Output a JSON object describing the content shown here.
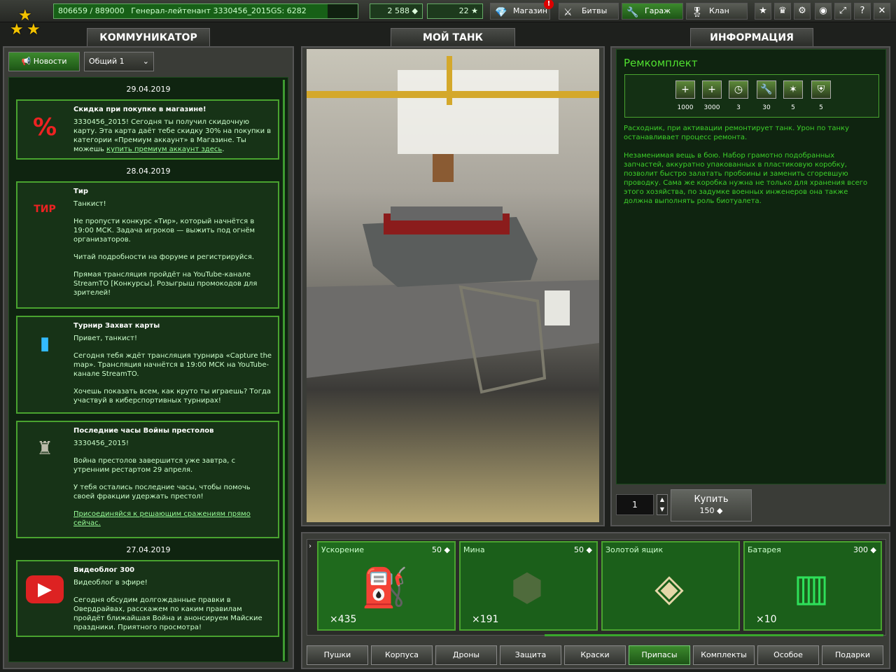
{
  "topbar": {
    "xp": "806659 / 889000",
    "rank": "Генерал-лейтенант 3330456_2015",
    "gs": "GS: 6282",
    "crystals": "2 588",
    "stars": "22",
    "nav": [
      {
        "label": "Магазин",
        "icon": "diamond-icon",
        "badge": "!"
      },
      {
        "label": "Битвы",
        "icon": "crossed-swords-icon"
      },
      {
        "label": "Гараж",
        "icon": "wrench-icon"
      },
      {
        "label": "Клан",
        "icon": "medal-icon"
      }
    ],
    "icons": [
      "star-icon",
      "trophy-icon",
      "gear-icon",
      "sound-icon",
      "fullscreen-icon",
      "help-icon",
      "close-icon"
    ]
  },
  "tabs": {
    "left": "КОММУНИКАТОР",
    "center": "МОЙ ТАНК",
    "right": "ИНФОРМАЦИЯ"
  },
  "comm": {
    "news_btn": "Новости",
    "channel": "Общий 1"
  },
  "news": [
    {
      "date": "29.04.2019",
      "items": [
        {
          "title": "Скидка при покупке в магазине!",
          "lines": [
            "3330456_2015! Сегодня ты получил скидочную карту. Эта карта даёт тебе скидку 30% на покупки в категории «Премиум аккаунт» в Магазине. Ты можешь "
          ],
          "link": "купить премиум аккаунт здесь",
          "tail": ".",
          "img": "%"
        }
      ]
    },
    {
      "date": "28.04.2019",
      "items": [
        {
          "title": "Тир",
          "lines": [
            "Танкист!",
            "Не пропусти конкурс «Тир», который начнётся в 19:00 МСК. Задача игроков — выжить под огнём организаторов.",
            "Читай подробности на форуме и регистрируйся.",
            "Прямая трансляция пройдёт на YouTube-канале StreamTO [Конкурсы]. Розыгрыш промокодов для зрителей!"
          ],
          "img": "ТИР"
        },
        {
          "title": "Турнир Захват карты",
          "lines": [
            "Привет, танкист!",
            "Сегодня тебя ждёт трансляция турнира «Capture the map». Трансляция начнётся в 19:00 МСК на YouTube-канале StreamTO.",
            "Хочешь показать всем, как круто ты играешь? Тогда участвуй в киберспортивных турнирах!"
          ],
          "img": "▮"
        },
        {
          "title": "Последние часы Войны престолов",
          "lines": [
            "3330456_2015!",
            "Война престолов завершится уже завтра, с утренним рестартом 29 апреля.",
            "У тебя остались последние часы, чтобы помочь своей фракции удержать престол!",
            "Присоединяйся к решающим сражениям прямо сейчас."
          ],
          "img": "♜"
        }
      ]
    },
    {
      "date": "27.04.2019",
      "items": [
        {
          "title": "Видеоблог 300",
          "lines": [
            "Видеоблог в эфире!",
            "Сегодня обсудим долгожданные правки в Овердрайвах, расскажем по каким правилам пройдёт ближайшая Война и анонсируем Майские праздники. Приятного просмотра!"
          ],
          "img": "▶"
        }
      ]
    }
  ],
  "info": {
    "title": "Ремкомплект",
    "stats": [
      {
        "icon": "health-plus-icon",
        "value": "1000"
      },
      {
        "icon": "health-timer-icon",
        "value": "3000"
      },
      {
        "icon": "stopwatch-icon",
        "value": "3"
      },
      {
        "icon": "wrench-timer-icon",
        "value": "30"
      },
      {
        "icon": "fire-timer-icon",
        "value": "5"
      },
      {
        "icon": "shield-timer-icon",
        "value": "5"
      }
    ],
    "desc1": "Расходник, при активации ремонтирует танк. Урон по танку останавливает процесс ремонта.",
    "desc2": "Незаменимая вещь в бою. Набор грамотно подобранных запчастей, аккуратно упакованных в пластиковую коробку, позволит быстро залатать пробоины и заменить сгоревшую проводку. Сама же коробка нужна не только для хранения всего этого хозяйства, по задумке военных инженеров она также должна выполнять роль биотуалета.",
    "qty": "1",
    "buy": "Купить",
    "price": "150"
  },
  "items": [
    {
      "name": "Ускорение",
      "price": "50",
      "count": "×435",
      "icon": "nitro-canister-icon"
    },
    {
      "name": "Мина",
      "price": "50",
      "count": "×191",
      "icon": "mine-icon"
    },
    {
      "name": "Золотой ящик",
      "price": "",
      "count": "",
      "icon": "gold-box-icon"
    },
    {
      "name": "Батарея",
      "price": "300",
      "count": "×10",
      "icon": "battery-icon"
    }
  ],
  "categories": [
    "Пушки",
    "Корпуса",
    "Дроны",
    "Защита",
    "Краски",
    "Припасы",
    "Комплекты",
    "Особое",
    "Подарки"
  ],
  "active_category": "Припасы"
}
